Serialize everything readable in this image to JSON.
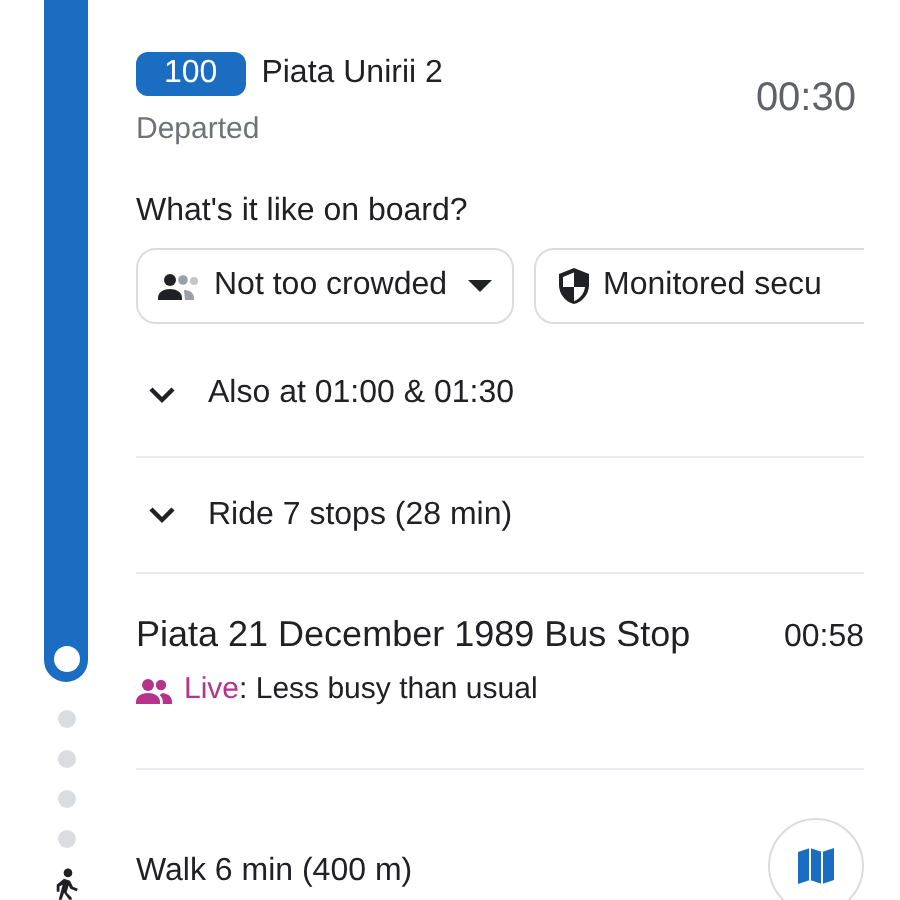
{
  "leg": {
    "route": "100",
    "headsign": "Piata Unirii 2",
    "status": "Departed",
    "time": "00:30"
  },
  "onboard": {
    "question": "What's it like on board?",
    "chips": [
      {
        "kind": "dropdown",
        "label": "Not too crowded"
      },
      {
        "kind": "shield",
        "label": "Monitored secu"
      }
    ]
  },
  "expanders": [
    {
      "label": "Also at 01:00 & 01:30",
      "expanded": false
    },
    {
      "label": "Ride 7 stops (28 min)",
      "expanded": false
    }
  ],
  "stop": {
    "name": "Piata 21 December 1989 Bus Stop",
    "time": "00:58",
    "live_label": "Live",
    "live_text": ": Less busy than usual"
  },
  "walk": {
    "text": "Walk 6 min (400 m)"
  }
}
